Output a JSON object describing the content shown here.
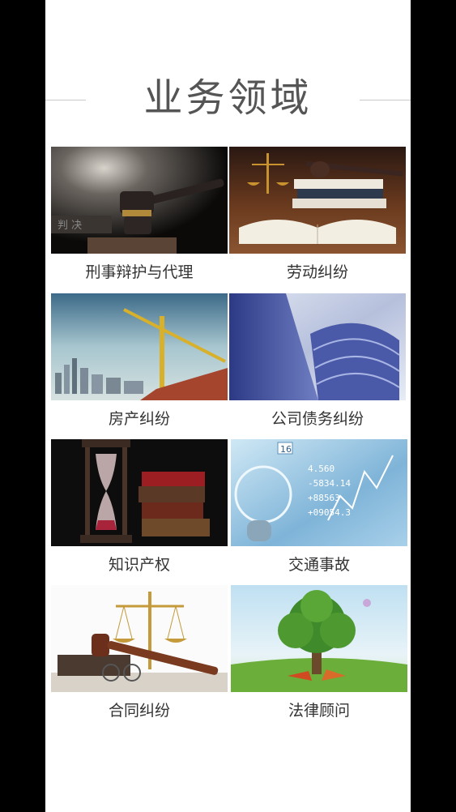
{
  "section": {
    "title": "业务领域"
  },
  "items": [
    {
      "label": "刑事辩护与代理",
      "image": "gavel-spotlight-image"
    },
    {
      "label": "劳动纠纷",
      "image": "scales-books-image"
    },
    {
      "label": "房产纠纷",
      "image": "crane-city-image"
    },
    {
      "label": "公司债务纠纷",
      "image": "skyscraper-image"
    },
    {
      "label": "知识产权",
      "image": "hourglass-books-image"
    },
    {
      "label": "交通事故",
      "image": "finance-numbers-image"
    },
    {
      "label": "合同纠纷",
      "image": "scales-gavel-glasses-image"
    },
    {
      "label": "法律顾问",
      "image": "tree-landscape-image"
    }
  ]
}
